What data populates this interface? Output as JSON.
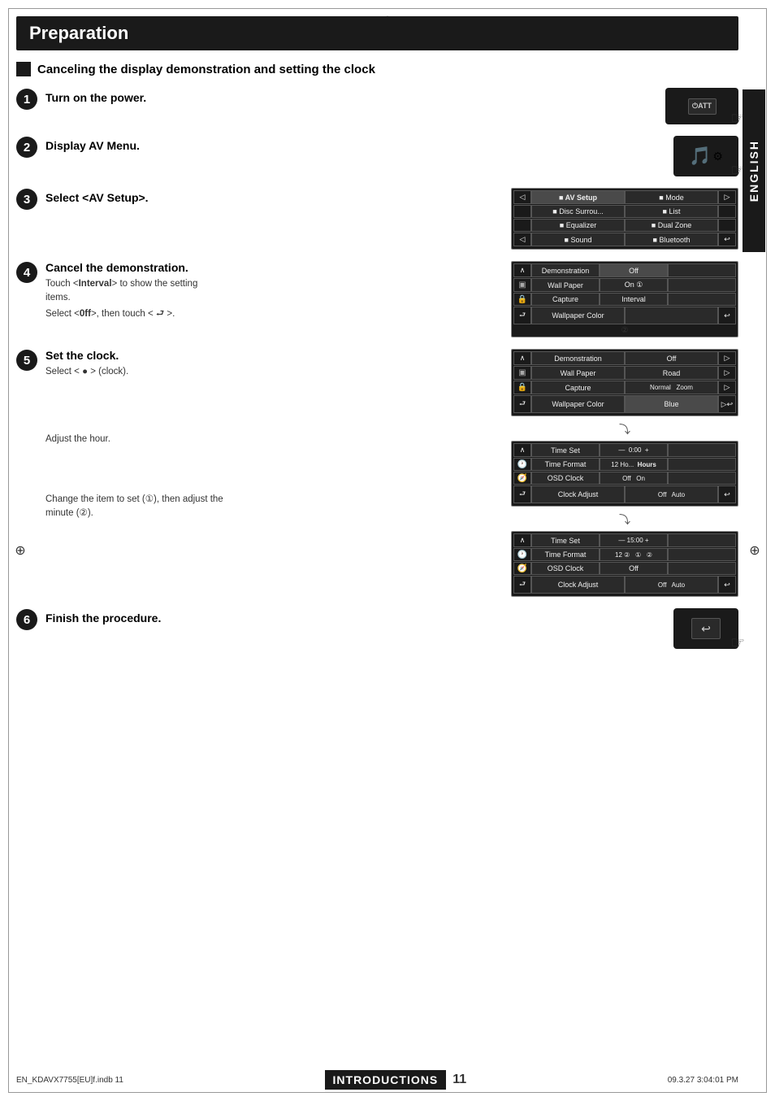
{
  "page": {
    "title": "Preparation",
    "section": {
      "icon": "■",
      "heading": "Canceling the display demonstration and setting the clock"
    },
    "steps": [
      {
        "number": "1",
        "title": "Turn on the power.",
        "sub": ""
      },
      {
        "number": "2",
        "title": "Display AV Menu.",
        "sub": ""
      },
      {
        "number": "3",
        "title": "Select <AV Setup>.",
        "sub": ""
      },
      {
        "number": "4",
        "title": "Cancel the demonstration.",
        "sub1": "Touch <Interval> to show the setting items.",
        "sub2": "Select <0ff>, then touch < ⮐ >."
      },
      {
        "number": "5",
        "title": "Set the clock.",
        "sub1": "Select < ● > (clock).",
        "sub2": "Adjust the hour.",
        "sub3": "Change the item to set (①), then adjust the minute (②)."
      },
      {
        "number": "6",
        "title": "Finish the procedure.",
        "sub": ""
      }
    ],
    "ui_panels": {
      "step3": {
        "rows": [
          [
            "nav_left",
            "AV Setup",
            "Mode",
            "nav_right"
          ],
          [
            "",
            "Disc Surround",
            "List",
            ""
          ],
          [
            "",
            "Equalizer",
            "Dual Zone",
            ""
          ],
          [
            "nav_back",
            "Sound",
            "Bluetooth",
            "nav_exit"
          ]
        ]
      },
      "step4_top": {
        "rows": [
          [
            "nav_up",
            "Demonstration",
            "Off",
            ""
          ],
          [
            "cam",
            "Wall Paper",
            "On ①",
            ""
          ],
          [
            "lock",
            "Capture",
            "Interval",
            ""
          ],
          [
            "nav_back",
            "Wallpaper Color",
            "",
            "nav_exit"
          ]
        ]
      },
      "step5_top": {
        "rows": [
          [
            "nav_up",
            "Demonstration",
            "Off",
            "▷"
          ],
          [
            "cam",
            "Wall Paper",
            "Road",
            "▷"
          ],
          [
            "lock",
            "Capture",
            "Normal  Zoom",
            "▷"
          ],
          [
            "nav_back",
            "Wallpaper Color",
            "Blue",
            "▷ nav_exit"
          ]
        ]
      },
      "step5_mid": {
        "rows": [
          [
            "nav_up",
            "Time Set",
            "— 0:00 +",
            ""
          ],
          [
            "clock",
            "Time Format",
            "12 Ho...  Hours",
            ""
          ],
          [
            "compass",
            "OSD Clock",
            "Off  On",
            ""
          ],
          [
            "nav_back",
            "Clock Adjust",
            "Off  Auto",
            "nav_exit"
          ]
        ]
      },
      "step5_bot": {
        "rows": [
          [
            "nav_up",
            "Time Set",
            "— 15:00 +",
            ""
          ],
          [
            "clock",
            "Time Format",
            "12 ② ①  ②",
            ""
          ],
          [
            "compass",
            "OSD Clock",
            "Off",
            ""
          ],
          [
            "nav_back",
            "Clock Adjust",
            "Off  Auto",
            "nav_exit"
          ]
        ]
      }
    },
    "footer": {
      "file_info": "EN_KDAVX7755[EU]f.indb   11",
      "date_info": "09.3.27   3:04:01 PM",
      "badge": "INTRODUCTIONS",
      "page_num": "11"
    },
    "sidebar": {
      "label": "ENGLISH"
    }
  }
}
